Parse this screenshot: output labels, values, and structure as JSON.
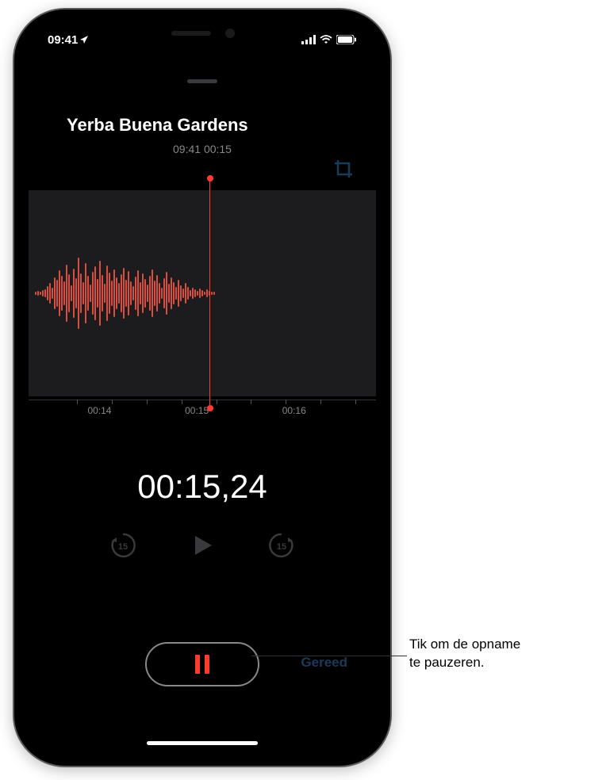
{
  "status": {
    "time": "09:41",
    "location_indicator": "➤"
  },
  "recording": {
    "title": "Yerba Buena Gardens",
    "timestamp": "09:41",
    "duration": "00:15",
    "meta_separator": "  "
  },
  "timeline": {
    "ticks": [
      "00:14",
      "00:15",
      "00:16"
    ]
  },
  "timer": {
    "display": "00:15,24"
  },
  "controls": {
    "skip_back_label": "15",
    "skip_forward_label": "15",
    "done_label": "Gereed"
  },
  "callout": {
    "line1": "Tik om de opname",
    "line2": "te pauzeren."
  }
}
